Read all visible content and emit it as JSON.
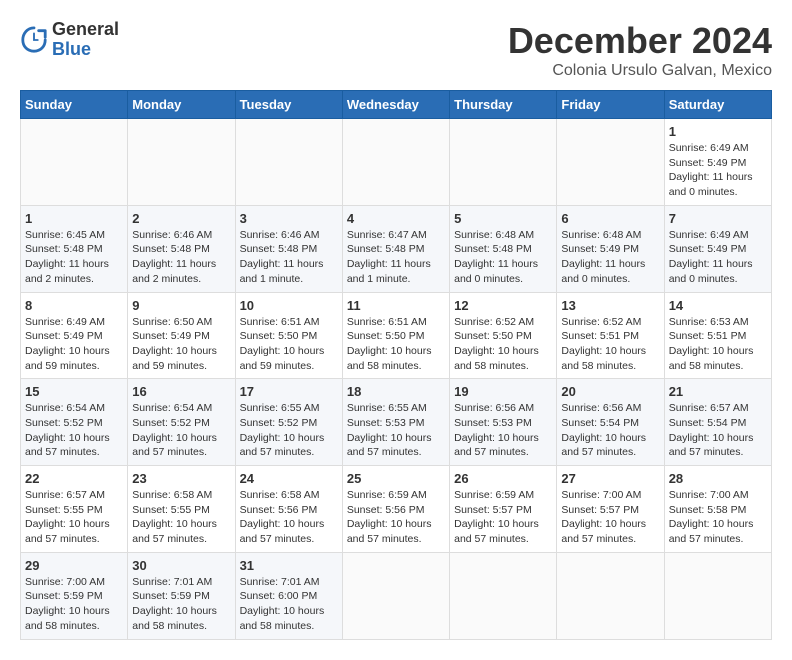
{
  "header": {
    "logo": {
      "general": "General",
      "blue": "Blue"
    },
    "title": "December 2024",
    "location": "Colonia Ursulo Galvan, Mexico"
  },
  "calendar": {
    "days_of_week": [
      "Sunday",
      "Monday",
      "Tuesday",
      "Wednesday",
      "Thursday",
      "Friday",
      "Saturday"
    ],
    "weeks": [
      [
        null,
        null,
        null,
        null,
        null,
        null,
        {
          "day": 1,
          "sunrise": "6:49 AM",
          "sunset": "5:49 PM",
          "daylight": "11 hours and 0 minutes."
        }
      ],
      [
        {
          "day": 1,
          "sunrise": "6:45 AM",
          "sunset": "5:48 PM",
          "daylight": "11 hours and 2 minutes."
        },
        {
          "day": 2,
          "sunrise": "6:46 AM",
          "sunset": "5:48 PM",
          "daylight": "11 hours and 2 minutes."
        },
        {
          "day": 3,
          "sunrise": "6:46 AM",
          "sunset": "5:48 PM",
          "daylight": "11 hours and 1 minute."
        },
        {
          "day": 4,
          "sunrise": "6:47 AM",
          "sunset": "5:48 PM",
          "daylight": "11 hours and 1 minute."
        },
        {
          "day": 5,
          "sunrise": "6:48 AM",
          "sunset": "5:48 PM",
          "daylight": "11 hours and 0 minutes."
        },
        {
          "day": 6,
          "sunrise": "6:48 AM",
          "sunset": "5:49 PM",
          "daylight": "11 hours and 0 minutes."
        },
        {
          "day": 7,
          "sunrise": "6:49 AM",
          "sunset": "5:49 PM",
          "daylight": "11 hours and 0 minutes."
        }
      ],
      [
        {
          "day": 8,
          "sunrise": "6:49 AM",
          "sunset": "5:49 PM",
          "daylight": "10 hours and 59 minutes."
        },
        {
          "day": 9,
          "sunrise": "6:50 AM",
          "sunset": "5:49 PM",
          "daylight": "10 hours and 59 minutes."
        },
        {
          "day": 10,
          "sunrise": "6:51 AM",
          "sunset": "5:50 PM",
          "daylight": "10 hours and 59 minutes."
        },
        {
          "day": 11,
          "sunrise": "6:51 AM",
          "sunset": "5:50 PM",
          "daylight": "10 hours and 58 minutes."
        },
        {
          "day": 12,
          "sunrise": "6:52 AM",
          "sunset": "5:50 PM",
          "daylight": "10 hours and 58 minutes."
        },
        {
          "day": 13,
          "sunrise": "6:52 AM",
          "sunset": "5:51 PM",
          "daylight": "10 hours and 58 minutes."
        },
        {
          "day": 14,
          "sunrise": "6:53 AM",
          "sunset": "5:51 PM",
          "daylight": "10 hours and 58 minutes."
        }
      ],
      [
        {
          "day": 15,
          "sunrise": "6:54 AM",
          "sunset": "5:52 PM",
          "daylight": "10 hours and 57 minutes."
        },
        {
          "day": 16,
          "sunrise": "6:54 AM",
          "sunset": "5:52 PM",
          "daylight": "10 hours and 57 minutes."
        },
        {
          "day": 17,
          "sunrise": "6:55 AM",
          "sunset": "5:52 PM",
          "daylight": "10 hours and 57 minutes."
        },
        {
          "day": 18,
          "sunrise": "6:55 AM",
          "sunset": "5:53 PM",
          "daylight": "10 hours and 57 minutes."
        },
        {
          "day": 19,
          "sunrise": "6:56 AM",
          "sunset": "5:53 PM",
          "daylight": "10 hours and 57 minutes."
        },
        {
          "day": 20,
          "sunrise": "6:56 AM",
          "sunset": "5:54 PM",
          "daylight": "10 hours and 57 minutes."
        },
        {
          "day": 21,
          "sunrise": "6:57 AM",
          "sunset": "5:54 PM",
          "daylight": "10 hours and 57 minutes."
        }
      ],
      [
        {
          "day": 22,
          "sunrise": "6:57 AM",
          "sunset": "5:55 PM",
          "daylight": "10 hours and 57 minutes."
        },
        {
          "day": 23,
          "sunrise": "6:58 AM",
          "sunset": "5:55 PM",
          "daylight": "10 hours and 57 minutes."
        },
        {
          "day": 24,
          "sunrise": "6:58 AM",
          "sunset": "5:56 PM",
          "daylight": "10 hours and 57 minutes."
        },
        {
          "day": 25,
          "sunrise": "6:59 AM",
          "sunset": "5:56 PM",
          "daylight": "10 hours and 57 minutes."
        },
        {
          "day": 26,
          "sunrise": "6:59 AM",
          "sunset": "5:57 PM",
          "daylight": "10 hours and 57 minutes."
        },
        {
          "day": 27,
          "sunrise": "7:00 AM",
          "sunset": "5:57 PM",
          "daylight": "10 hours and 57 minutes."
        },
        {
          "day": 28,
          "sunrise": "7:00 AM",
          "sunset": "5:58 PM",
          "daylight": "10 hours and 57 minutes."
        }
      ],
      [
        {
          "day": 29,
          "sunrise": "7:00 AM",
          "sunset": "5:59 PM",
          "daylight": "10 hours and 58 minutes."
        },
        {
          "day": 30,
          "sunrise": "7:01 AM",
          "sunset": "5:59 PM",
          "daylight": "10 hours and 58 minutes."
        },
        {
          "day": 31,
          "sunrise": "7:01 AM",
          "sunset": "6:00 PM",
          "daylight": "10 hours and 58 minutes."
        },
        null,
        null,
        null,
        null
      ]
    ]
  }
}
